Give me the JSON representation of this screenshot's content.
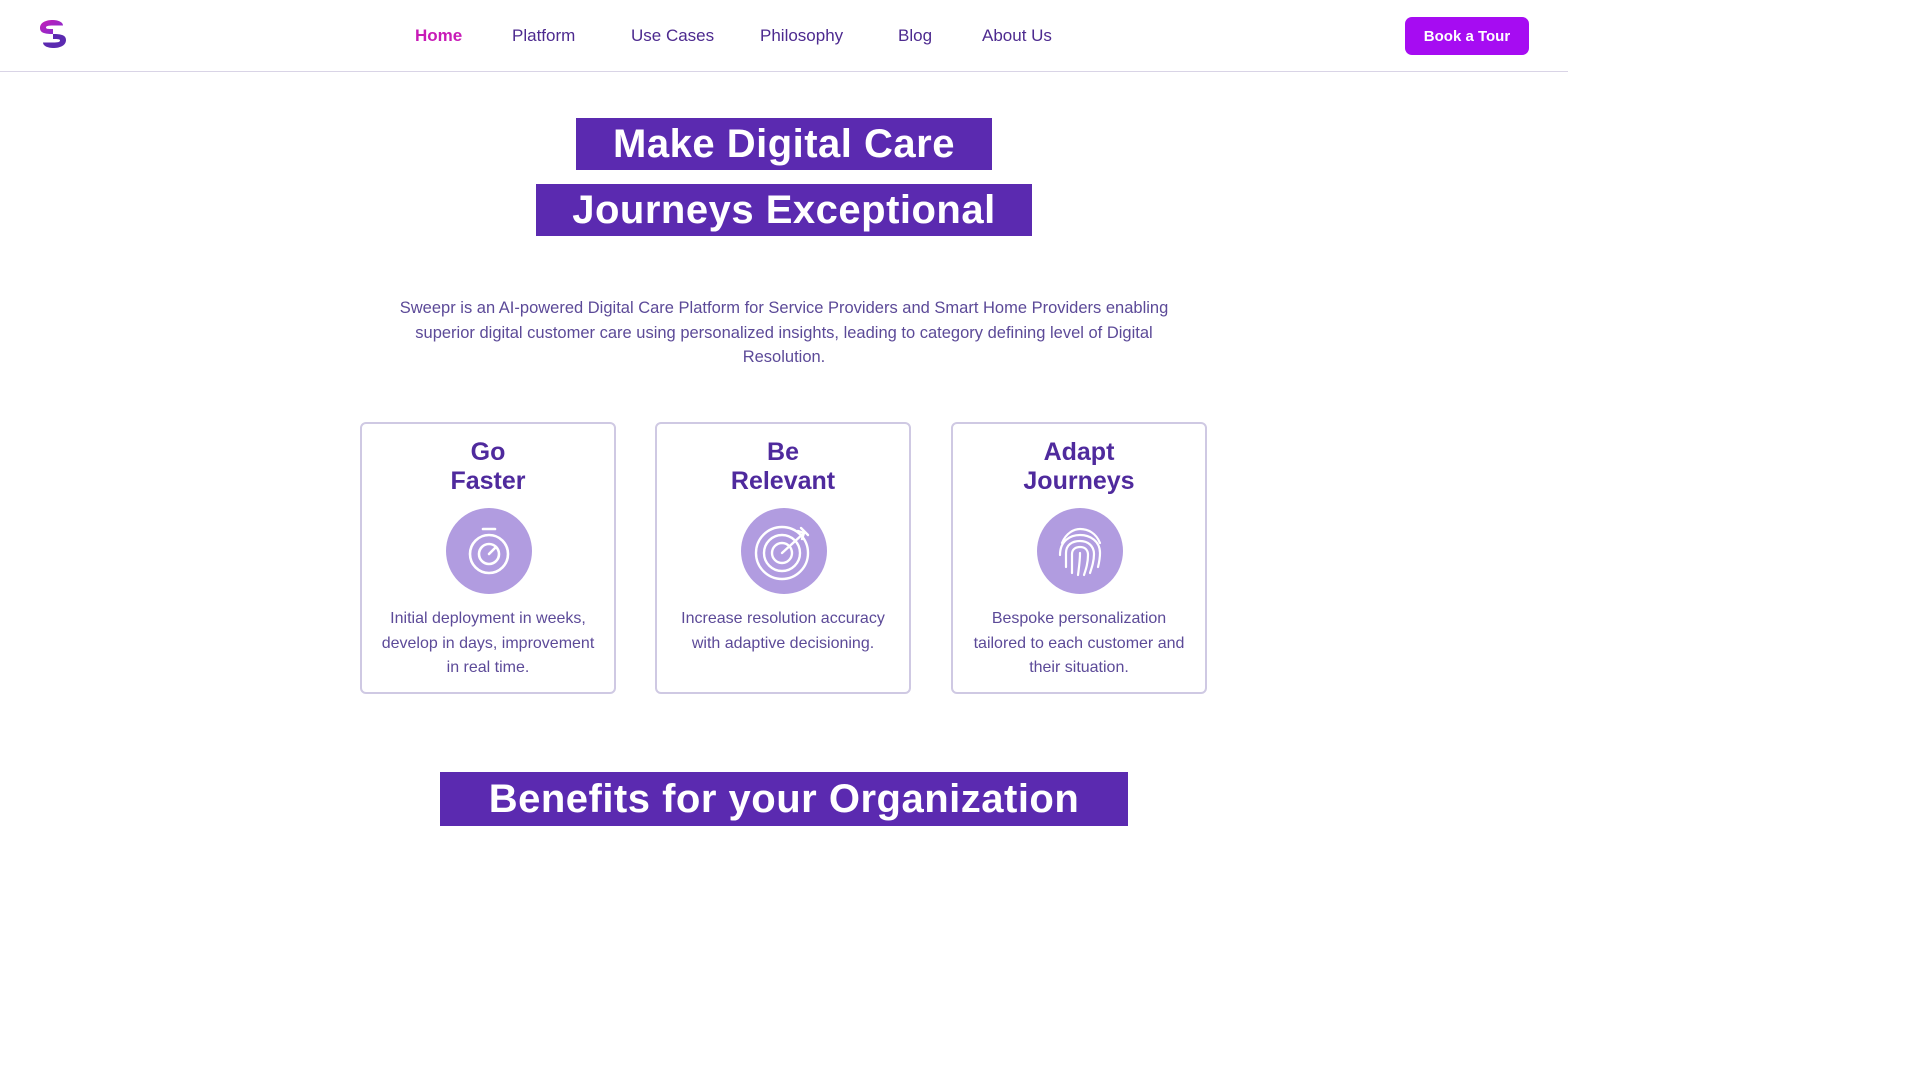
{
  "header": {
    "logo_icon": "sweepr-s-logo",
    "nav": [
      {
        "label": "Home",
        "active": true
      },
      {
        "label": "Platform",
        "active": false
      },
      {
        "label": "Use Cases",
        "active": false
      },
      {
        "label": "Philosophy",
        "active": false
      },
      {
        "label": "Blog",
        "active": false
      },
      {
        "label": "About Us",
        "active": false
      }
    ],
    "cta_label": "Book a Tour"
  },
  "hero": {
    "line1": "Make Digital Care",
    "line2": "Journeys Exceptional",
    "description": "Sweepr is an AI-powered Digital Care Platform for Service Providers and Smart Home Providers enabling superior digital customer care using personalized insights, leading to category defining level of Digital Resolution."
  },
  "cards": [
    {
      "title_line1": "Go",
      "title_line2": "Faster",
      "icon": "stopwatch-icon",
      "text": "Initial deployment in weeks, develop in days, improvement in real time."
    },
    {
      "title_line1": "Be",
      "title_line2": "Relevant",
      "icon": "target-icon",
      "text": "Increase resolution accuracy with adaptive decisioning."
    },
    {
      "title_line1": "Adapt",
      "title_line2": "Journeys",
      "icon": "fingerprint-icon",
      "text": "Bespoke personalization tailored to each customer and their situation."
    }
  ],
  "benefits_heading": "Benefits for your Organization",
  "colors": {
    "brand_purple": "#5b2ab0",
    "nav_text": "#4d2a8f",
    "nav_active": "#c81bb7",
    "cta_bg": "#a60cf2",
    "icon_bg": "#b19ce0",
    "card_border": "#cfc9e3"
  }
}
